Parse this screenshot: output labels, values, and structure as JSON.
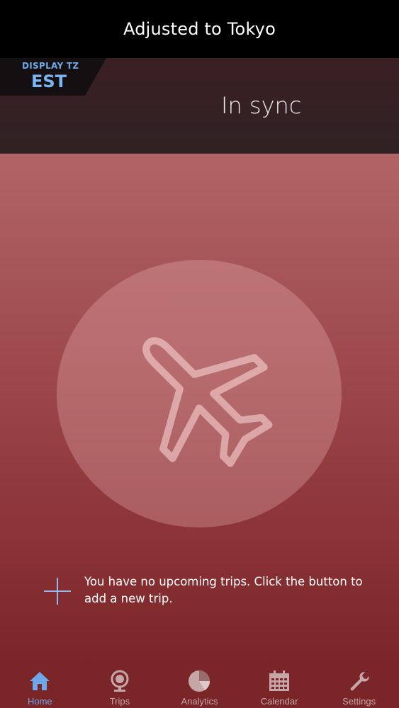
{
  "topbar": {
    "title": "Adjusted to Tokyo"
  },
  "header": {
    "display_tz_label": "DISPLAY TZ",
    "display_tz_value": "EST",
    "sync_status": "In sync"
  },
  "empty_state": {
    "icon": "airplane-icon",
    "message": "You have no upcoming trips. Click the button to add a new trip."
  },
  "tabs": [
    {
      "label": "Home",
      "icon": "home-icon",
      "active": true
    },
    {
      "label": "Trips",
      "icon": "globe-icon",
      "active": false
    },
    {
      "label": "Analytics",
      "icon": "pie-chart-icon",
      "active": false
    },
    {
      "label": "Calendar",
      "icon": "calendar-icon",
      "active": false
    },
    {
      "label": "Settings",
      "icon": "wrench-icon",
      "active": false
    }
  ],
  "colors": {
    "accent": "#6fa8e8",
    "tab_inactive": "#c6a6a7",
    "background_top": "#b16466",
    "background_bottom": "#7a2528"
  }
}
